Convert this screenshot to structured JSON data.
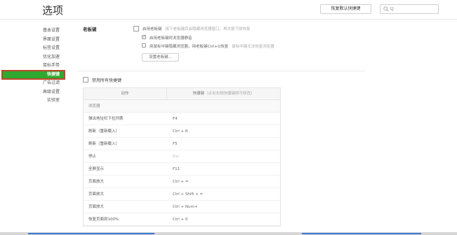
{
  "header": {
    "title": "选项",
    "restore_button": "恢复默认快捷键",
    "search_placeholder": "Q"
  },
  "sidebar": {
    "items": [
      {
        "label": "基本设置"
      },
      {
        "label": "界面设置"
      },
      {
        "label": "标签设置"
      },
      {
        "label": "优化加速"
      },
      {
        "label": "鼠标手势"
      },
      {
        "label": "快捷键",
        "active": true
      },
      {
        "label": "广告过滤"
      },
      {
        "label": "高级设置"
      },
      {
        "label": "实验室"
      }
    ]
  },
  "boss_key": {
    "title": "老板键",
    "enable_label": "启用老板键",
    "enable_hint": "按下老板键后会隐藏浏览器窗口，再次按下即恢复",
    "mute_label": "启用老板键时浏览器静音",
    "mouse_label": "用鼠标中键隐藏浏览器，用老板键Ctrl+Q恢复",
    "mouse_hint": "鼠标中键无法恢复浏览器",
    "set_button": "设置老板键..."
  },
  "shortcuts": {
    "disable_all_label": "禁用所有快捷键",
    "col_action": "动作",
    "col_key": "快捷键",
    "col_key_hint": "（点击右侧快捷键即可修改）",
    "group": "浏览器",
    "rows": [
      {
        "action": "弹出地址栏下拉列表",
        "key": "F4"
      },
      {
        "action": "刷新（重新载入）",
        "key": "Ctrl + R"
      },
      {
        "action": "刷新（重新载入）",
        "key": "F5"
      },
      {
        "action": "停止",
        "key": "Esc",
        "muted": true
      },
      {
        "action": "全屏显示",
        "key": "F11"
      },
      {
        "action": "页面放大",
        "key": "Ctrl + ="
      },
      {
        "action": "页面放大",
        "key": "Ctrl + Shift + ="
      },
      {
        "action": "页面放大",
        "key": "Ctrl + Num+"
      },
      {
        "action": "恢复页面到100%",
        "key": "Ctrl + 0"
      }
    ]
  },
  "colors": {
    "active_nav": "#2fa82f",
    "active_outline": "#c0462d",
    "taskbar_accent": "#3b7bd6"
  }
}
